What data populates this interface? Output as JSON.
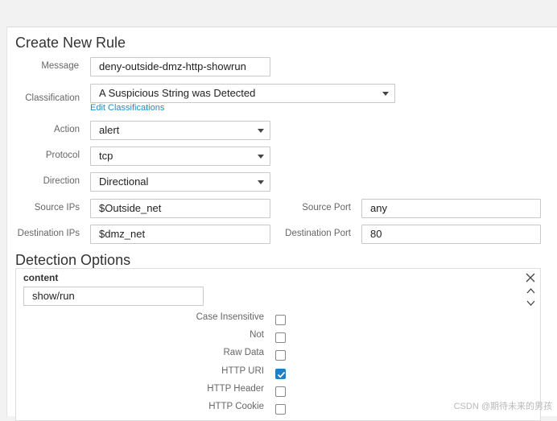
{
  "form": {
    "title": "Create New Rule",
    "message_label": "Message",
    "message_value": "deny-outside-dmz-http-showrun",
    "classification_label": "Classification",
    "classification_value": "A Suspicious String was Detected",
    "edit_classifications_link": "Edit Classifications",
    "action_label": "Action",
    "action_value": "alert",
    "protocol_label": "Protocol",
    "protocol_value": "tcp",
    "direction_label": "Direction",
    "direction_value": "Directional",
    "source_ips_label": "Source IPs",
    "source_ips_value": "$Outside_net",
    "source_port_label": "Source Port",
    "source_port_value": "any",
    "destination_ips_label": "Destination IPs",
    "destination_ips_value": "$dmz_net",
    "destination_port_label": "Destination Port",
    "destination_port_value": "80"
  },
  "detection": {
    "title": "Detection Options",
    "content_label": "content",
    "content_value": "show/run",
    "options": [
      {
        "label": "Case Insensitive",
        "checked": false
      },
      {
        "label": "Not",
        "checked": false
      },
      {
        "label": "Raw Data",
        "checked": false
      },
      {
        "label": "HTTP URI",
        "checked": true
      },
      {
        "label": "HTTP Header",
        "checked": false
      },
      {
        "label": "HTTP Cookie",
        "checked": false
      }
    ]
  },
  "icons": {
    "close": "close-icon",
    "move_up": "chevron-up-icon",
    "move_down": "chevron-down-icon",
    "select_caret": "caret-down-icon"
  },
  "colors": {
    "link": "#1a8fc9",
    "checkbox_checked": "#1f7fc4"
  },
  "watermark": "CSDN @期待未来的男孩"
}
